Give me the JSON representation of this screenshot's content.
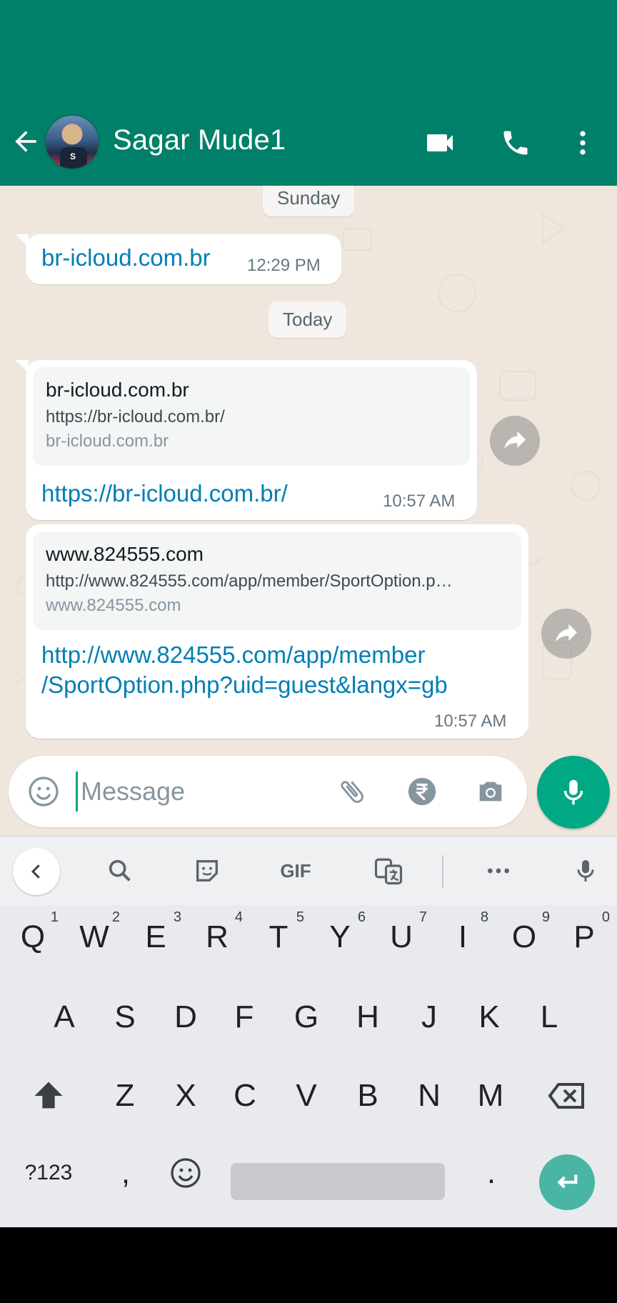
{
  "header": {
    "contact_name": "Sagar Mude1",
    "avatar_letter": "S",
    "color": "#008069"
  },
  "chat": {
    "date_sunday": "Sunday",
    "date_today": "Today",
    "messages": [
      {
        "text": "br-icloud.com.br",
        "time": "12:29 PM"
      },
      {
        "preview_title": "br-icloud.com.br",
        "preview_url": "https://br-icloud.com.br/",
        "preview_domain": "br-icloud.com.br",
        "text": "https://br-icloud.com.br/",
        "time": "10:57 AM"
      },
      {
        "preview_title": "www.824555.com",
        "preview_url": "http://www.824555.com/app/member/SportOption.p…",
        "preview_domain": "www.824555.com",
        "text_line1": "http://www.824555.com/app/member",
        "text_line2": "/SportOption.php?uid=guest&langx=gb",
        "time": "10:57 AM"
      }
    ]
  },
  "composer": {
    "placeholder": "Message"
  },
  "keyboard": {
    "row1": [
      {
        "k": "Q",
        "n": "1"
      },
      {
        "k": "W",
        "n": "2"
      },
      {
        "k": "E",
        "n": "3"
      },
      {
        "k": "R",
        "n": "4"
      },
      {
        "k": "T",
        "n": "5"
      },
      {
        "k": "Y",
        "n": "6"
      },
      {
        "k": "U",
        "n": "7"
      },
      {
        "k": "I",
        "n": "8"
      },
      {
        "k": "O",
        "n": "9"
      },
      {
        "k": "P",
        "n": "0"
      }
    ],
    "row2": [
      "A",
      "S",
      "D",
      "F",
      "G",
      "H",
      "J",
      "K",
      "L"
    ],
    "row3": [
      "Z",
      "X",
      "C",
      "V",
      "B",
      "N",
      "M"
    ],
    "symbols_label": "?123",
    "comma": ",",
    "period": ".",
    "gif_label": "GIF"
  }
}
